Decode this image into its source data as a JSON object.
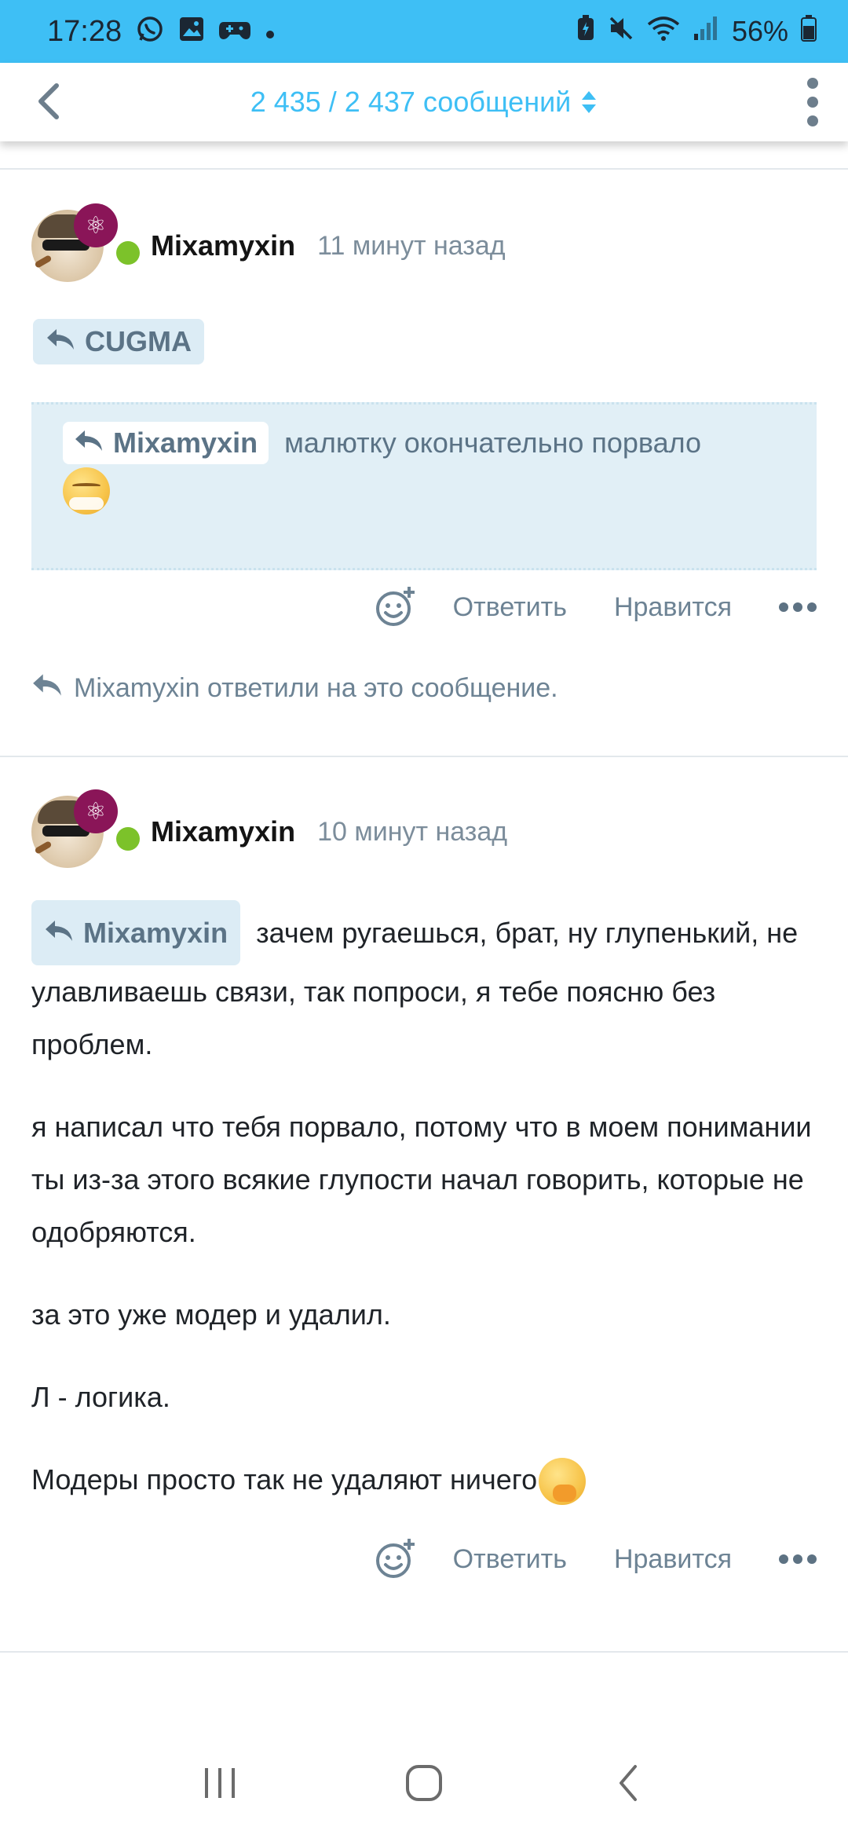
{
  "status_bar": {
    "time": "17:28",
    "battery": "56%",
    "left_icons": [
      "whatsapp-icon",
      "gallery-icon",
      "game-controller-icon",
      "dot-icon"
    ],
    "right_icons": [
      "battery-saver-icon",
      "mute-icon",
      "wifi-icon",
      "signal-icon",
      "battery-icon"
    ]
  },
  "header": {
    "counter": "2 435 / 2 437 сообщений",
    "accent_color": "#3ebff5"
  },
  "posts": [
    {
      "username": "Mixamyxin",
      "time_ago": "11 минут назад",
      "reply_to": "CUGMA",
      "quote": {
        "author": "Mixamyxin",
        "text": "малютку окончательно порвало"
      },
      "actions": {
        "reply": "Ответить",
        "like": "Нравится"
      },
      "replied_note": "Mixamyxin ответили на это сообщение."
    },
    {
      "username": "Mixamyxin",
      "time_ago": "10 минут назад",
      "reply_to": "Mixamyxin",
      "paragraphs": [
        "зачем ругаешься, брат, ну глупенький, не улавливаешь связи, так попроси, я тебе поясню без проблем.",
        "я написал что тебя порвало, потому что в моем понимании ты из-за этого всякие глупости начал говорить, которые не одобряются.",
        "за это уже модер и удалил.",
        "Л - логика.",
        "Модеры просто так не удаляют ничего"
      ],
      "actions": {
        "reply": "Ответить",
        "like": "Нравится"
      }
    }
  ],
  "nav": [
    "recent-apps-icon",
    "home-icon",
    "back-icon"
  ]
}
